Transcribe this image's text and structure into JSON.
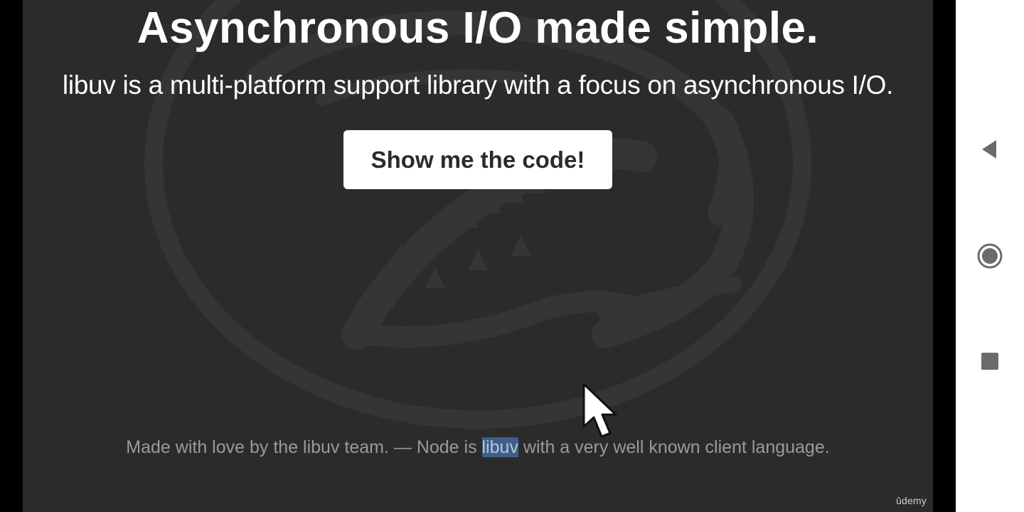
{
  "slide": {
    "headline": "Asynchronous I/O made simple.",
    "tagline": "libuv is a multi-platform support library with a focus on asynchronous I/O.",
    "cta_label": "Show me the code!",
    "footer": {
      "before": "Made with love by the libuv team. — Node is ",
      "highlight": "libuv",
      "after": " with a very well known client language."
    },
    "watermark": "ûdemy"
  },
  "colors": {
    "slide_background": "#2b2b2b",
    "logo_tint": "#353535",
    "highlight": "#3f5f8a",
    "nav_bar": "#ffffff",
    "nav_icon": "#6b6b6b"
  },
  "icons": {
    "logo": "libuv-dinosaur-logo",
    "cursor": "mouse-pointer-icon",
    "back": "back-triangle-icon",
    "home": "home-circle-icon",
    "recent": "recent-apps-square-icon"
  }
}
